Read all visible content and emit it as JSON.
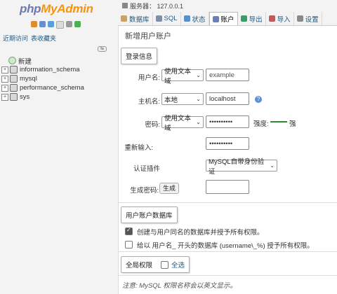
{
  "nav": {
    "logo_php": "php",
    "logo_myadmin": "MyAdmin",
    "links": [
      "近期访问",
      "表收藏夹"
    ],
    "tree": [
      {
        "label": "新建",
        "type": "new"
      },
      {
        "label": "information_schema",
        "type": "db"
      },
      {
        "label": "mysql",
        "type": "db"
      },
      {
        "label": "performance_schema",
        "type": "db"
      },
      {
        "label": "sys",
        "type": "db"
      }
    ]
  },
  "topbar": {
    "server": "服务器： 127.0.0.1",
    "tabs": [
      {
        "label": "数据库",
        "icon": "database-icon"
      },
      {
        "label": "SQL",
        "icon": "sql-icon"
      },
      {
        "label": "状态",
        "icon": "status-icon"
      },
      {
        "label": "账户",
        "icon": "accounts-icon"
      },
      {
        "label": "导出",
        "icon": "export-icon"
      },
      {
        "label": "导入",
        "icon": "import-icon"
      },
      {
        "label": "设置",
        "icon": "wrench-icon"
      }
    ]
  },
  "page": {
    "title": "新增用户账户",
    "login": {
      "legend": "登录信息",
      "username_label": "用户名:",
      "username_type": "使用文本域",
      "username_placeholder": "example",
      "host_label": "主机名:",
      "host_type": "本地",
      "host_value": "localhost",
      "password_label": "密码:",
      "password_type": "使用文本域",
      "password_value": "••••••••••",
      "strength_label": "强度:",
      "strength_value": "强",
      "retype_label": "重新输入:",
      "retype_value": "••••••••••",
      "auth_label": "认证插件",
      "auth_value": "MySQL自带身份验证",
      "generate_label": "生成密码:",
      "generate_button": "生成"
    },
    "database": {
      "legend": "用户账户数据库",
      "option1": "创建与用户同名的数据库并授予所有权限。",
      "option1_checked": true,
      "option2": "给以 用户名_ 开头的数据库 (username\\_%) 授予所有权限。",
      "option2_checked": false
    },
    "global": {
      "legend": "全局权限",
      "check_all": "全选"
    },
    "note": "注意: MySQL 权限名称会以英文显示。"
  },
  "colors": {
    "link": "#235a81",
    "strength": "#2e8b2e"
  }
}
